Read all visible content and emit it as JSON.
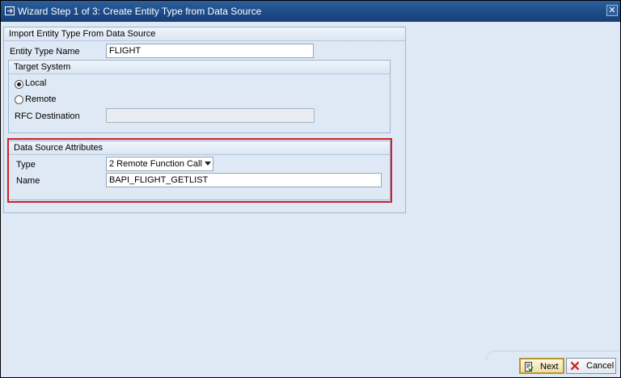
{
  "window": {
    "title": "Wizard Step 1 of 3: Create Entity Type from Data Source",
    "close_glyph": "✕"
  },
  "import_group": {
    "title": "Import Entity Type From Data Source",
    "entity_type_name_label": "Entity Type Name",
    "entity_type_name_value": "FLIGHT"
  },
  "target_system": {
    "title": "Target System",
    "local_label": "Local",
    "local_selected": true,
    "remote_label": "Remote",
    "remote_selected": false,
    "rfc_destination_label": "RFC Destination",
    "rfc_destination_value": ""
  },
  "data_source": {
    "title": "Data Source Attributes",
    "type_label": "Type",
    "type_value": "2 Remote Function Call",
    "name_label": "Name",
    "name_value": "BAPI_FLIGHT_GETLIST"
  },
  "buttons": {
    "next_label": "Next",
    "cancel_label": "Cancel"
  },
  "colors": {
    "highlight": "#d0202a",
    "titlebar": "#1b4a86",
    "background": "#dfe9f5"
  }
}
